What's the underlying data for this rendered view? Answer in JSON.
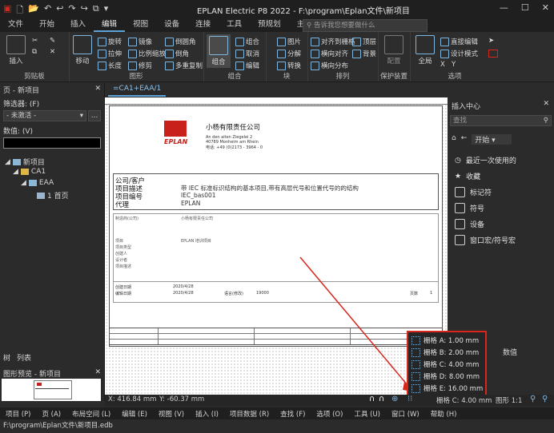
{
  "app": {
    "title": "EPLAN Electric P8 2022 - F:\\program\\Eplan文件\\新项目",
    "minimize": "—",
    "maximize": "☐",
    "close": "✕"
  },
  "menu_tabs": [
    "文件",
    "开始",
    "插入",
    "编辑",
    "视图",
    "设备",
    "连接",
    "工具",
    "预规划",
    "主数据"
  ],
  "active_tab": "编辑",
  "search_placeholder": "告诉我您想要做什么",
  "ribbon": {
    "clipboard": {
      "label": "剪贴板",
      "insert": "插入"
    },
    "graphics": {
      "label": "图形",
      "move": "移动",
      "rotate": "旋转",
      "mirror": "镜像",
      "round": "倒圆角",
      "stretch": "拉伸",
      "scale": "比例缩放",
      "chamfer": "倒角",
      "length": "长度",
      "trim": "修剪",
      "multicopy": "多重复制"
    },
    "group": {
      "label": "组合",
      "group_btn": "组合",
      "combine": "组合",
      "cancel": "取消",
      "edit": "编辑"
    },
    "block": {
      "label": "块",
      "picture": "图片",
      "decompose": "分解",
      "convert": "转换"
    },
    "arrange": {
      "label": "排列",
      "align_grid": "对齐到栅格",
      "top": "顶层",
      "horizontal": "横向对齐",
      "background": "背景",
      "distribute": "横向分布"
    },
    "protection": {
      "label": "保护装置",
      "config": "配置"
    },
    "options": {
      "label": "选项",
      "fullscreen": "全局",
      "direct_edit": "直接编辑",
      "design_mode": "设计模式",
      "x": "X",
      "y": "Y"
    }
  },
  "left_panel": {
    "title": "页 - 新项目",
    "filter_label": "筛选器: (F)",
    "filter_value": "- 未激活 -",
    "value_label": "数值: (V)",
    "tree": [
      {
        "label": "新项目",
        "level": 0
      },
      {
        "label": "CA1",
        "level": 1
      },
      {
        "label": "EAA",
        "level": 2
      },
      {
        "label": "1 首页",
        "level": 3
      }
    ],
    "tabs": [
      "树",
      "列表"
    ],
    "preview_title": "图形预览 - 新项目"
  },
  "document_tab": "=CA1+EAA/1",
  "sheet": {
    "company": "小杨有限责任公司",
    "address_line1": "An den alten Ziegelei 2",
    "address_line2": "40789   Monheim am Rhein",
    "address_line3": "电话: +49 (0)2173 - 3964 - 0",
    "logo_text": "EPLAN",
    "rows": [
      {
        "label": "公司/客户",
        "value": ""
      },
      {
        "label": "项目描述",
        "value": "带 IEC 标准标识结构的基本项目,带有高层代号和位置代号的的结构"
      },
      {
        "label": "项目编号",
        "value": "IEC_bas001"
      },
      {
        "label": "代理",
        "value": "EPLAN"
      }
    ],
    "small_rows": [
      "制造商(公司)",
      "项目",
      "项目类型",
      "创建人",
      "设计者",
      "项目描述"
    ],
    "small_vals": [
      "小杨有限责任公司",
      "EPLAN 培训项目"
    ],
    "date_created_label": "创建日期",
    "date_created": "2020/4/28",
    "date_edited_label": "编辑日期",
    "date_edited": "2020/4/28",
    "language_label": "语言(修改)",
    "language_val": "19000",
    "pages_label": "页数",
    "pages_val": "1"
  },
  "right_panel": {
    "title": "插入中心",
    "search_placeholder": "查找",
    "nav_start": "开始",
    "items": [
      "最近一次使用的",
      "收藏",
      "标记符",
      "符号",
      "设备",
      "窗口宏/符号宏"
    ],
    "value_header": "数值"
  },
  "grid_popup": {
    "options": [
      "栅格 A: 1.00 mm",
      "栅格 B: 2.00 mm",
      "栅格 C: 4.00 mm",
      "栅格 D: 8.00 mm",
      "栅格 E: 16.00 mm"
    ]
  },
  "status": {
    "x": "X: 416.84 mm",
    "y": "Y: -60.37 mm",
    "grid": "栅格 C: 4.00 mm",
    "scale": "图形 1:1"
  },
  "bottom_menu": [
    "项目 (P)",
    "页 (A)",
    "布局空间 (L)",
    "编辑 (E)",
    "视图 (V)",
    "插入 (I)",
    "项目数据 (R)",
    "查找 (F)",
    "选项 (O)",
    "工具 (U)",
    "窗口 (W)",
    "帮助 (H)"
  ],
  "path": "F:\\program\\Eplan文件\\新项目.edb",
  "colors": {
    "accent": "#5ba3d8",
    "highlight": "#d9261c",
    "logo_red": "#c8201b"
  }
}
